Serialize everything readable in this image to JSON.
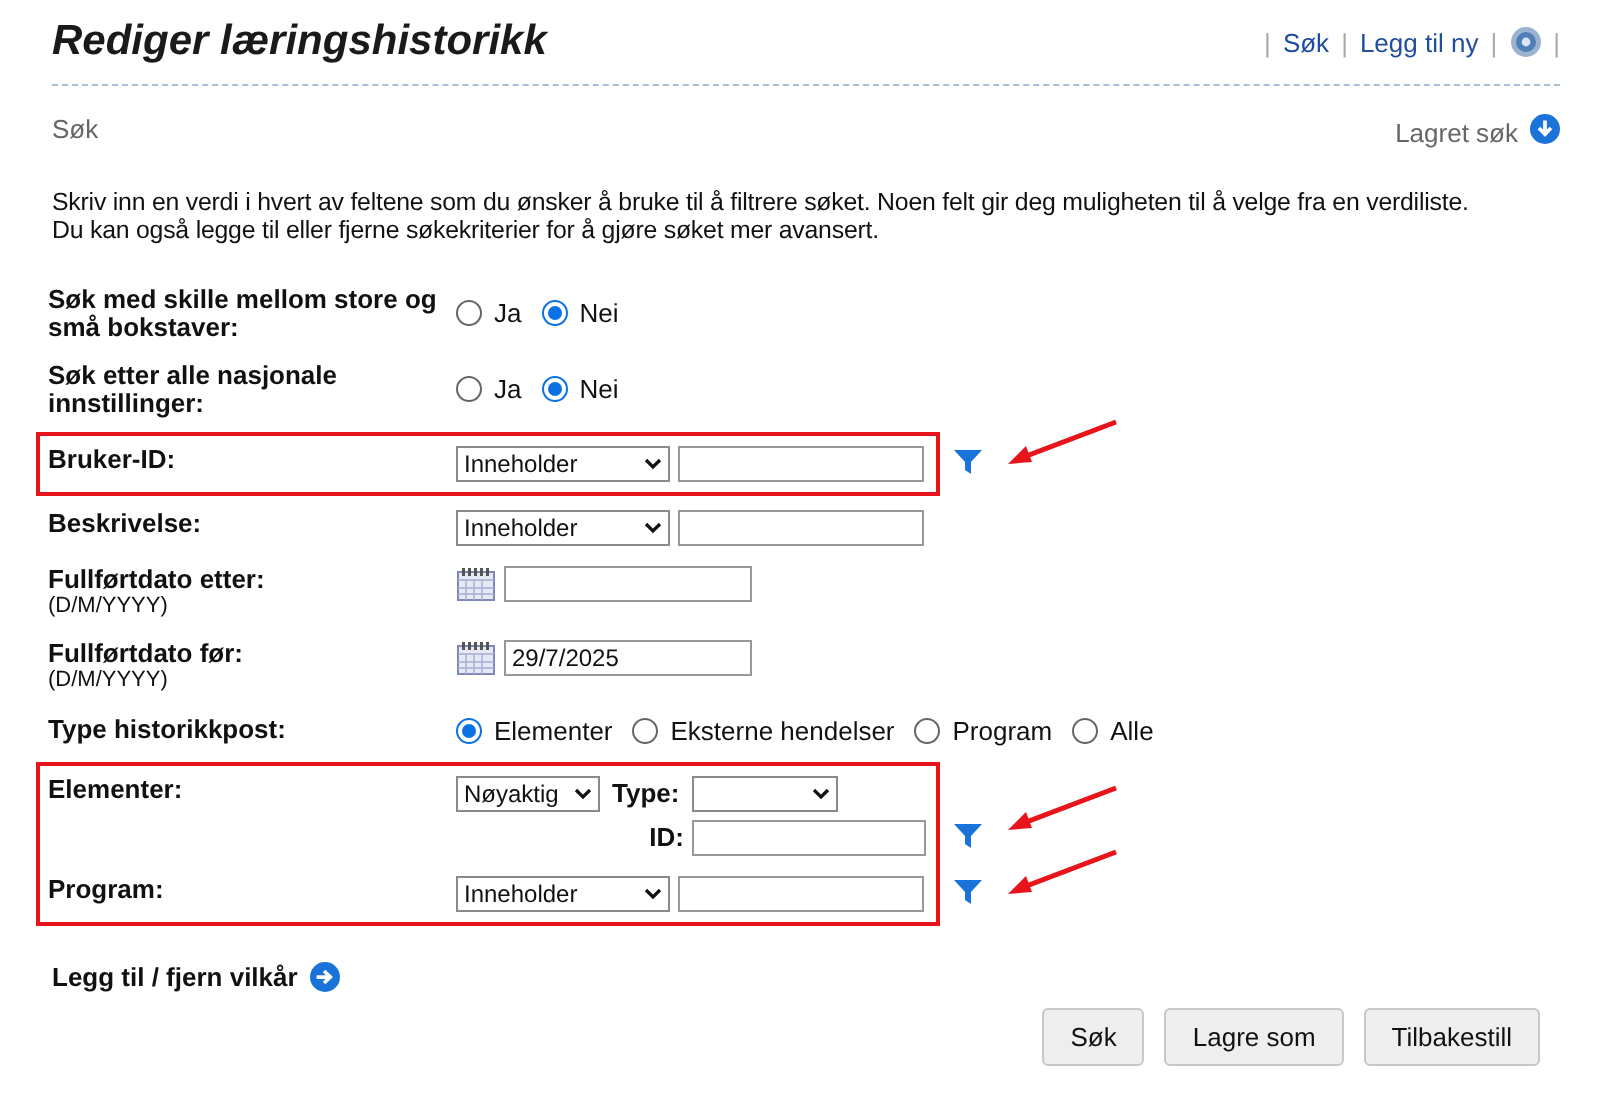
{
  "title": "Rediger læringshistorikk",
  "header_links": [
    "Søk",
    "Legg til ny"
  ],
  "header_separators": [
    "|",
    "|",
    "|",
    "|"
  ],
  "section": {
    "label": "Søk",
    "saved_search": "Lagret søk"
  },
  "instructions": "Skriv inn en verdi i hvert av feltene som du ønsker å bruke til å filtrere søket. Noen felt gir deg muligheten til å velge fra en verdiliste.\nDu kan også legge til eller fjerne søkekriterier for å gjøre søket mer avansert.",
  "groups": [
    {
      "highlighted": false,
      "rows": [
        {
          "kind": "radio",
          "label": "Søk med skille mellom store og små bokstaver:",
          "options": [
            {
              "label": "Ja",
              "selected": false
            },
            {
              "label": "Nei",
              "selected": true
            }
          ]
        },
        {
          "kind": "radio",
          "label": "Søk etter alle nasjonale innstillinger:",
          "options": [
            {
              "label": "Ja",
              "selected": false
            },
            {
              "label": "Nei",
              "selected": true
            }
          ]
        }
      ]
    },
    {
      "highlighted": true,
      "rows": [
        {
          "kind": "select_text",
          "label": "Bruker-ID:",
          "select": "Inneholder",
          "filter": true
        }
      ]
    },
    {
      "highlighted": false,
      "rows": [
        {
          "kind": "select_text",
          "label": "Beskrivelse:",
          "select": "Inneholder",
          "filter": false
        },
        {
          "kind": "date",
          "label": "Fullførtdato etter:",
          "hint": "(D/M/YYYY)"
        },
        {
          "kind": "date",
          "label": "Fullførtdato før:",
          "hint": "(D/M/YYYY)",
          "value": "29/7/2025"
        },
        {
          "kind": "radio",
          "label": "Type historikkpost:",
          "options": [
            {
              "label": "Elementer",
              "selected": true
            },
            {
              "label": "Eksterne hendelser",
              "selected": false
            },
            {
              "label": "Program",
              "selected": false
            },
            {
              "label": "Alle",
              "selected": false
            }
          ]
        }
      ]
    },
    {
      "highlighted": true,
      "rows": [
        {
          "kind": "elements",
          "label": "Elementer:",
          "select": "Nøyaktig",
          "type_label": "Type:",
          "id_label": "ID:",
          "filter": true
        },
        {
          "kind": "select_text",
          "label": "Program:",
          "select": "Inneholder",
          "filter": true
        }
      ]
    }
  ],
  "add_remove": "Legg til / fjern vilkår",
  "buttons": [
    "Søk",
    "Lagre som",
    "Tilbakestill"
  ]
}
